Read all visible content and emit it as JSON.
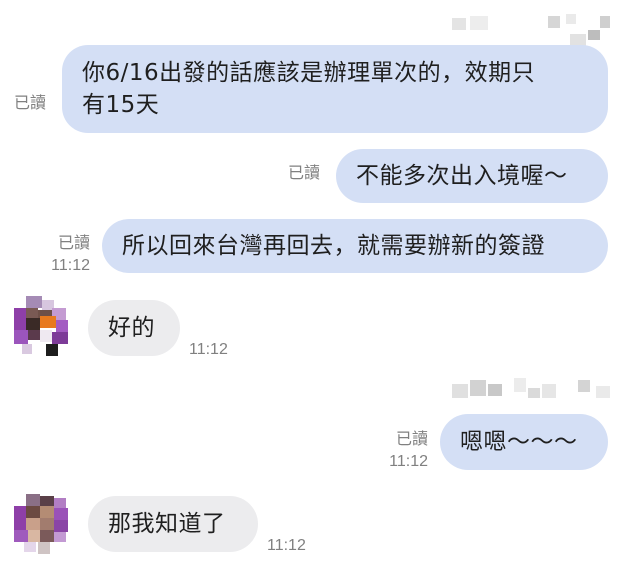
{
  "messages": [
    {
      "id": "m1",
      "direction": "outgoing",
      "lines": [
        "你6/16出發的話應該是辦理單次的，效期只",
        "有15天"
      ],
      "read_label": "已讀",
      "time": ""
    },
    {
      "id": "m2",
      "direction": "outgoing",
      "lines": [
        "不能多次出入境喔～"
      ],
      "read_label": "已讀",
      "time": ""
    },
    {
      "id": "m3",
      "direction": "outgoing",
      "lines": [
        "所以回來台灣再回去，就需要辦新的簽證"
      ],
      "read_label": "已讀",
      "time": "11:12"
    },
    {
      "id": "m4",
      "direction": "incoming",
      "lines": [
        "好的"
      ],
      "time": "11:12"
    },
    {
      "id": "m5",
      "direction": "outgoing",
      "lines": [
        "嗯嗯～～～"
      ],
      "read_label": "已讀",
      "time": "11:12"
    },
    {
      "id": "m6",
      "direction": "incoming",
      "lines": [
        "那我知道了"
      ],
      "time": "11:12"
    }
  ],
  "colors": {
    "outgoing_bubble": "#d4dff5",
    "incoming_bubble": "#ececee",
    "meta_text": "#808080",
    "avatar_accent": "#8e3fa8"
  },
  "icons": {
    "avatar": "pixelated-avatar-icon",
    "redacted": "pixelated-redaction"
  }
}
